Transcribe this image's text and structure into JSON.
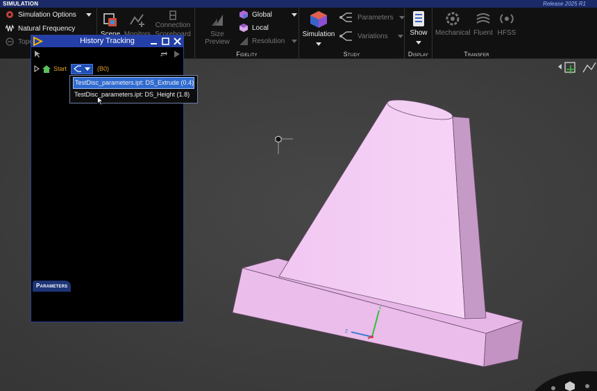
{
  "window": {
    "tab": "SIMULATION",
    "release": "Release 2025 R1"
  },
  "ribbon": {
    "sim_left": {
      "items": [
        {
          "label": "Simulation Options",
          "icon": "gear-icon"
        },
        {
          "label": "Natural Frequency",
          "icon": "wave-icon"
        },
        {
          "label": "Topo",
          "icon": "topology-icon"
        }
      ]
    },
    "scene": {
      "label": "Scene"
    },
    "monitors": {
      "label": "Monitors"
    },
    "connection": {
      "label": "Connection",
      "sublabel": "Scoreboard"
    },
    "fidelity": {
      "label": "Fidelity",
      "size_preview": "Size Preview",
      "global": "Global",
      "local": "Local",
      "resolution": "Resolution"
    },
    "study": {
      "label": "Study",
      "simulation": "Simulation",
      "parameters": "Parameters",
      "variations": "Variations"
    },
    "display": {
      "label": "Display",
      "show": "Show"
    },
    "transfer": {
      "label": "Transfer",
      "mechanical": "Mechanical",
      "fluent": "Fluent",
      "hfss": "HFSS"
    }
  },
  "history": {
    "title": "History Tracking",
    "start_label": "Start",
    "badge": "(B0)",
    "options": [
      "TestDisc_parameters.ipt: DS_Extrude (0.4)",
      "TestDisc_parameters.ipt: DS_Height (1.8)"
    ],
    "tab": "Parameters"
  },
  "colors": {
    "ribbon_bg": "#111111",
    "title_bar": "#2440a8",
    "model": "#eabdea",
    "accent_orange": "#e2a12a"
  }
}
